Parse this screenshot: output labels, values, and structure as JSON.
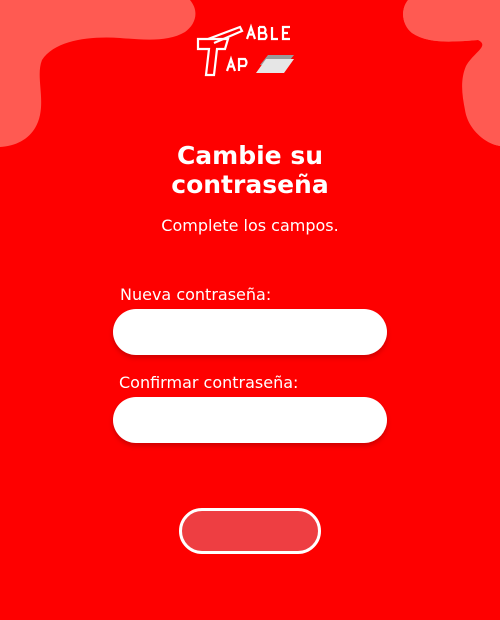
{
  "brand": {
    "logo_text": "TABLE TAP"
  },
  "heading": {
    "title_line1": "Cambie su",
    "title_line2": "contraseña",
    "subtitle": "Complete los campos."
  },
  "form": {
    "new_password_label": "Nueva contraseña:",
    "new_password_value": "",
    "confirm_password_label": "Confirmar contraseña:",
    "confirm_password_value": "",
    "submit_label": ""
  },
  "colors": {
    "background": "#fe0000",
    "blob": "#ff5a52",
    "button_fill": "#ee3e42",
    "text": "#ffffff"
  }
}
